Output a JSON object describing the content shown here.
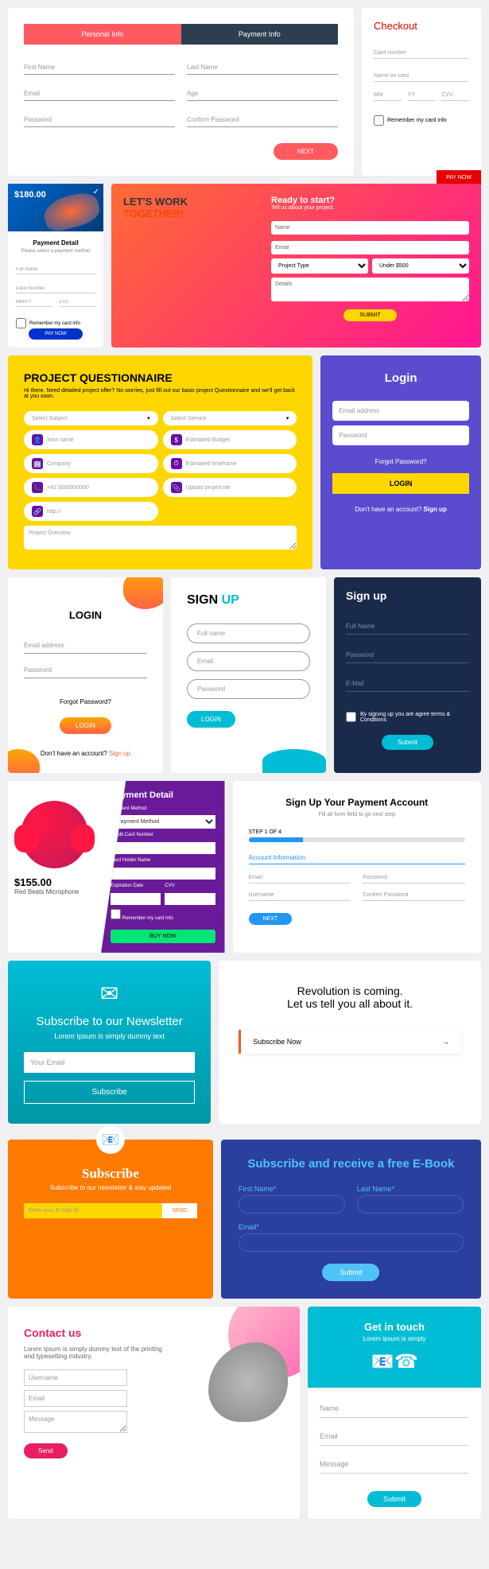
{
  "c1": {
    "tab1": "Personal Info",
    "tab2": "Payment Info",
    "f": [
      "First Name",
      "Last Name",
      "Email",
      "Age",
      "Password",
      "Confirm Password"
    ],
    "btn": "NEXT"
  },
  "c2": {
    "title": "Checkout",
    "f": [
      "Card number",
      "Name on card",
      "MM",
      "YY",
      "CVV"
    ],
    "chk": "Remember my card info",
    "btn": "PAY NOW"
  },
  "c3": {
    "price": "$180.00",
    "title": "Payment Detail",
    "sub": "Please select a payment method",
    "f": [
      "Full Name",
      "Card Number",
      "MM/YY",
      "CVV"
    ],
    "chk": "Remember my card info",
    "btn": "PAY NOW"
  },
  "c4": {
    "h1": "LET'S WORK",
    "h2": "TOGETHER!",
    "t": "Ready to start?",
    "sub": "Tell us about your project.",
    "f": [
      "Name",
      "Email",
      "Project Type",
      "Under $500",
      "Details"
    ],
    "btn": "SUBMIT"
  },
  "c5": {
    "title": "PROJECT QUESTIONNAIRE",
    "sub": "Hi there. Need detailed project offer? No worries, just fill out our basic project Questionnaire and we'll get back at you soon.",
    "f": [
      "Select Subject",
      "Select Service",
      "Your name",
      "Estimated Budget",
      "Company",
      "Estimated timeframe",
      "+91 0000000000",
      "Upload project file",
      "http://"
    ],
    "ta": "Project Overview"
  },
  "c6": {
    "title": "Login",
    "f": [
      "Email address",
      "Password"
    ],
    "forgot": "Forgot Password?",
    "btn": "LOGIN",
    "foot": "Don't have an account? ",
    "link": "Sign up"
  },
  "c7": {
    "title": "LOGIN",
    "f": [
      "Email address",
      "Password"
    ],
    "forgot": "Forgot Password?",
    "btn": "LOGIN",
    "foot": "Don't have an account? ",
    "link": "Sign up"
  },
  "c8": {
    "t1": "SIGN ",
    "t2": "UP",
    "f": [
      "Full name",
      "Email",
      "Password"
    ],
    "btn": "LOGIN"
  },
  "c9": {
    "title": "Sign up",
    "f": [
      "Full Name",
      "Password",
      "E-Mail"
    ],
    "chk": "By signing up you are agree terms & Conditions",
    "btn": "Submit"
  },
  "c10": {
    "price": "$155.00",
    "name": "Red Beats Microphone",
    "title": "Payment Detail",
    "l": [
      "Payment Method",
      "Credit Card Number",
      "Card Holder Name",
      "Expiration Date",
      "CVV"
    ],
    "sel": "Payment Method",
    "chk": "Remember my card info",
    "btn": "BUY NOW"
  },
  "c11": {
    "title": "Sign Up Your Payment Account",
    "sub": "Fill all form field to go next step",
    "step": "STEP 1 OF 4",
    "sec": "Account Information:",
    "f": [
      "Email",
      "Password",
      "Username",
      "Confirm Password"
    ],
    "btn": "NEXT"
  },
  "c12": {
    "title": "Subscribe to our Newsletter",
    "sub": "Lorem Ipsum is simply dummy text",
    "ph": "Your Email",
    "btn": "Subscribe"
  },
  "c13": {
    "l1": "Revolution is coming.",
    "l2": "Let us tell you all about it.",
    "btn": "Subscribe Now"
  },
  "c14": {
    "title": "Subscribe",
    "sub": "Subscribe to our newsletter & stay updated",
    "ph": "Enter your E-mail ID",
    "btn": "SEND"
  },
  "c15": {
    "title": "Subscribe and receive a free E-Book",
    "l": [
      "First Name*",
      "Last Name*",
      "Email*"
    ],
    "btn": "Submit"
  },
  "c16": {
    "title": "Contact us",
    "sub": "Lorem Ipsum is simply dummy text of the printing and typesetting industry.",
    "f": [
      "Username",
      "Email",
      "Message"
    ],
    "btn": "Send"
  },
  "c17": {
    "title": "Get in touch",
    "sub": "Lorem ipsum is simply",
    "f": [
      "Name",
      "Email",
      "Message"
    ],
    "btn": "Submit"
  }
}
